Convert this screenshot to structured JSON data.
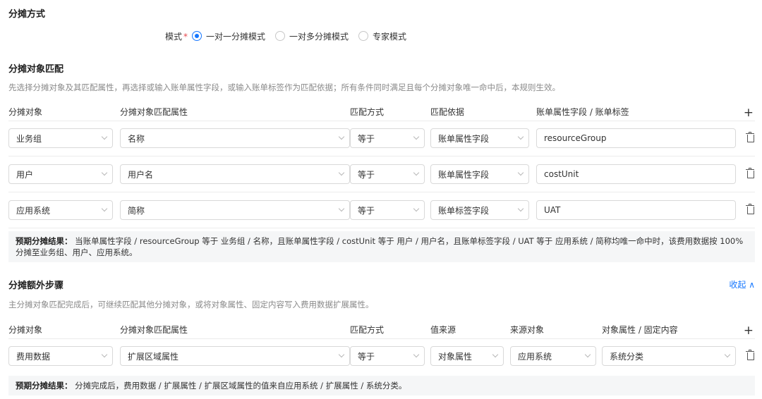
{
  "allocation_method": {
    "title": "分摊方式",
    "mode_label": "模式",
    "required_mark": "*",
    "options": [
      "一对一分摊模式",
      "一对多分摊模式",
      "专家模式"
    ],
    "selected_index": 0
  },
  "match": {
    "title": "分摊对象匹配",
    "description": "先选择分摊对象及其匹配属性，再选择或输入账单属性字段，或输入账单标签作为匹配依据；所有条件同时满足且每个分摊对象唯一命中后，本规则生效。",
    "headers": [
      "分摊对象",
      "分摊对象匹配属性",
      "匹配方式",
      "匹配依据",
      "账单属性字段 / 账单标签"
    ],
    "add_icon": "+",
    "rows": [
      {
        "object": "业务组",
        "attr": "名称",
        "method": "等于",
        "basis": "账单属性字段",
        "value": "resourceGroup"
      },
      {
        "object": "用户",
        "attr": "用户名",
        "method": "等于",
        "basis": "账单属性字段",
        "value": "costUnit"
      },
      {
        "object": "应用系统",
        "attr": "简称",
        "method": "等于",
        "basis": "账单标签字段",
        "value": "UAT"
      }
    ],
    "result_label": "预期分摊结果：",
    "result_text": "当账单属性字段 / resourceGroup 等于 业务组 / 名称，且账单属性字段 / costUnit 等于 用户 / 用户名，且账单标签字段 / UAT 等于 应用系统 / 简称均唯一命中时，该费用数据按 100% 分摊至业务组、用户、应用系统。"
  },
  "extra": {
    "title": "分摊额外步骤",
    "collapse_label": "收起 ∧",
    "description": "主分摊对象匹配完成后，可继续匹配其他分摊对象，或将对象属性、固定内容写入费用数据扩展属性。",
    "headers": [
      "分摊对象",
      "分摊对象匹配属性",
      "匹配方式",
      "值来源",
      "来源对象",
      "对象属性 / 固定内容"
    ],
    "add_icon": "+",
    "rows": [
      {
        "object": "费用数据",
        "attr": "扩展区域属性",
        "method": "等于",
        "source": "对象属性",
        "source_obj": "应用系统",
        "content": "系统分类"
      }
    ],
    "result_label": "预期分摊结果：",
    "result_text": "分摊完成后，费用数据 / 扩展属性 / 扩展区域属性的值来自应用系统 / 扩展属性 / 系统分类。"
  },
  "colors": {
    "accent": "#1677ff",
    "required": "#e5484d",
    "result_bg": "#f5f6f7"
  }
}
